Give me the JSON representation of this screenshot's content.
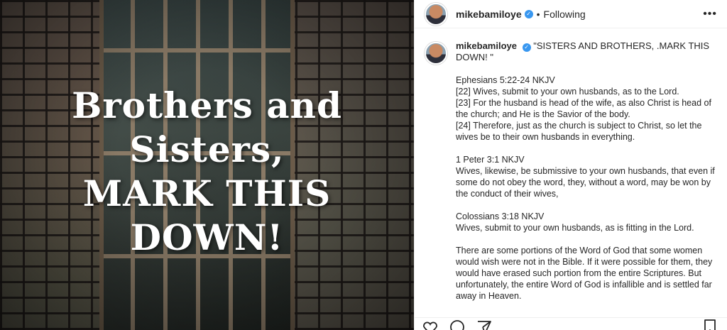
{
  "post_image": {
    "text_lines": [
      "Brothers and",
      "Sisters,",
      "MARK THIS",
      "DOWN!"
    ]
  },
  "header": {
    "username": "mikebamiloye",
    "separator": "•",
    "following_label": "Following",
    "more_label": "•••"
  },
  "caption": {
    "username": "mikebamiloye",
    "headline": "\"SISTERS AND BROTHERS, .MARK THIS DOWN! \"",
    "body": "Ephesians 5:22-24 NKJV\n[22] Wives, submit to your own husbands, as to the Lord.\n[23] For the husband is head of the wife, as also Christ is head of the church; and He is the Savior of the body.\n[24] Therefore, just as the church is subject to Christ, so let the wives be to their own husbands in everything.\n\n1 Peter 3:1 NKJV\nWives, likewise, be submissive to your own husbands, that even if some do not obey the word, they, without a word, may be won by the conduct of their wives,\n\nColossians 3:18 NKJV\nWives, submit to your own husbands, as is fitting in the Lord.\n\nThere are some portions of the Word of God that some women would wish were not in the Bible. If it were possible for them, they would have erased such portion from the entire Scriptures. But unfortunately, the entire Word of God is infallible and is settled far away in Heaven."
  },
  "colors": {
    "verified": "#3897f0",
    "text": "#262626",
    "border": "#efefef"
  },
  "icons": [
    "heart-icon",
    "comment-icon",
    "share-icon",
    "bookmark-icon",
    "verified-icon",
    "more-icon"
  ]
}
